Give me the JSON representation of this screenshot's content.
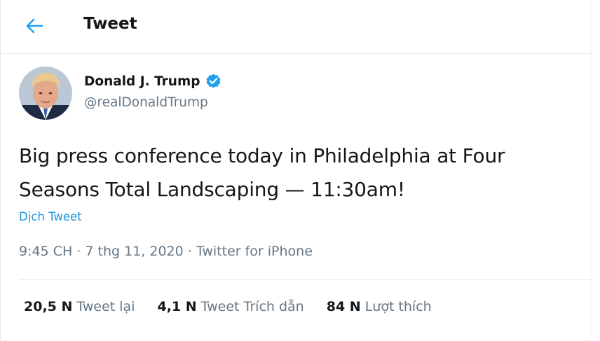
{
  "header": {
    "title": "Tweet",
    "back_icon": "arrow-left-icon"
  },
  "colors": {
    "accent": "#1da1f2",
    "link": "#1b95e0",
    "text": "#14171a",
    "muted": "#657786",
    "border": "#e6ecf0"
  },
  "author": {
    "name": "Donald J. Trump",
    "handle": "@realDonaldTrump",
    "verified_icon": "verified-badge-icon"
  },
  "tweet": {
    "text": "Big press conference today in Philadelphia at Four Seasons Total Landscaping — 11:30am!",
    "translate_label": "Dịch Tweet",
    "time": "9:45 CH",
    "date": "7 thg 11, 2020",
    "source": "Twitter for iPhone",
    "separator": "·"
  },
  "stats": [
    {
      "count": "20,5 N",
      "label": "Tweet lại"
    },
    {
      "count": "4,1 N",
      "label": "Tweet Trích dẫn"
    },
    {
      "count": "84 N",
      "label": "Lượt thích"
    }
  ]
}
